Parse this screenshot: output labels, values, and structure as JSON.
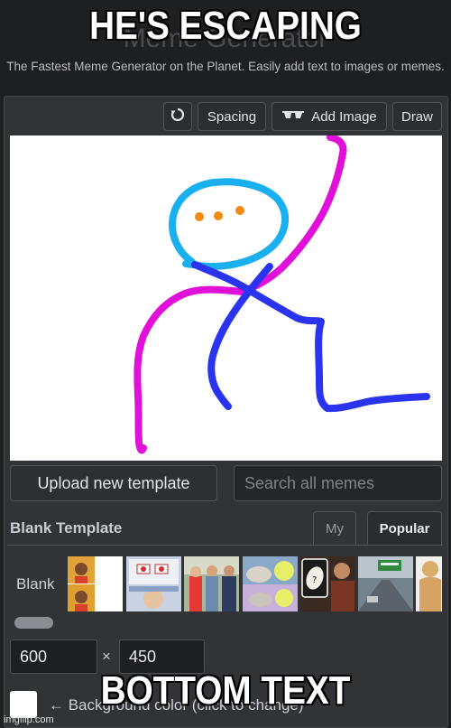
{
  "header": {
    "site_title": "Meme Generator",
    "subtitle": "The Fastest Meme Generator on the Planet. Easily add text to images or memes."
  },
  "toolbar": {
    "reset_icon": "rotate-icon",
    "spacing_label": "Spacing",
    "add_image_icon": "sunglasses-icon",
    "add_image_label": "Add Image",
    "draw_label": "Draw"
  },
  "editor": {
    "upload_label": "Upload new template",
    "search_placeholder": "Search all memes"
  },
  "templates": {
    "heading": "Blank Template",
    "tabs": [
      {
        "label": "My",
        "active": false
      },
      {
        "label": "Popular",
        "active": true
      }
    ],
    "blank_label": "Blank",
    "thumbnails": [
      "drake",
      "panik-kalm",
      "distracted-boyfriend",
      "monkey-puppet",
      "uno-draw-25",
      "godfather",
      "left-exit-12",
      "buff-doge"
    ]
  },
  "size": {
    "width": "600",
    "height": "450",
    "separator": "×"
  },
  "background": {
    "label": "← Background color (click to change)"
  },
  "meme_text": {
    "top": "HE'S ESCAPING",
    "bottom": "BOTTOM TEXT"
  },
  "watermark": "imgflip.com",
  "colors": {
    "cyan": "#1ab0f0",
    "magenta": "#e010d8",
    "blue": "#2a34ef",
    "orange": "#f28a12"
  }
}
